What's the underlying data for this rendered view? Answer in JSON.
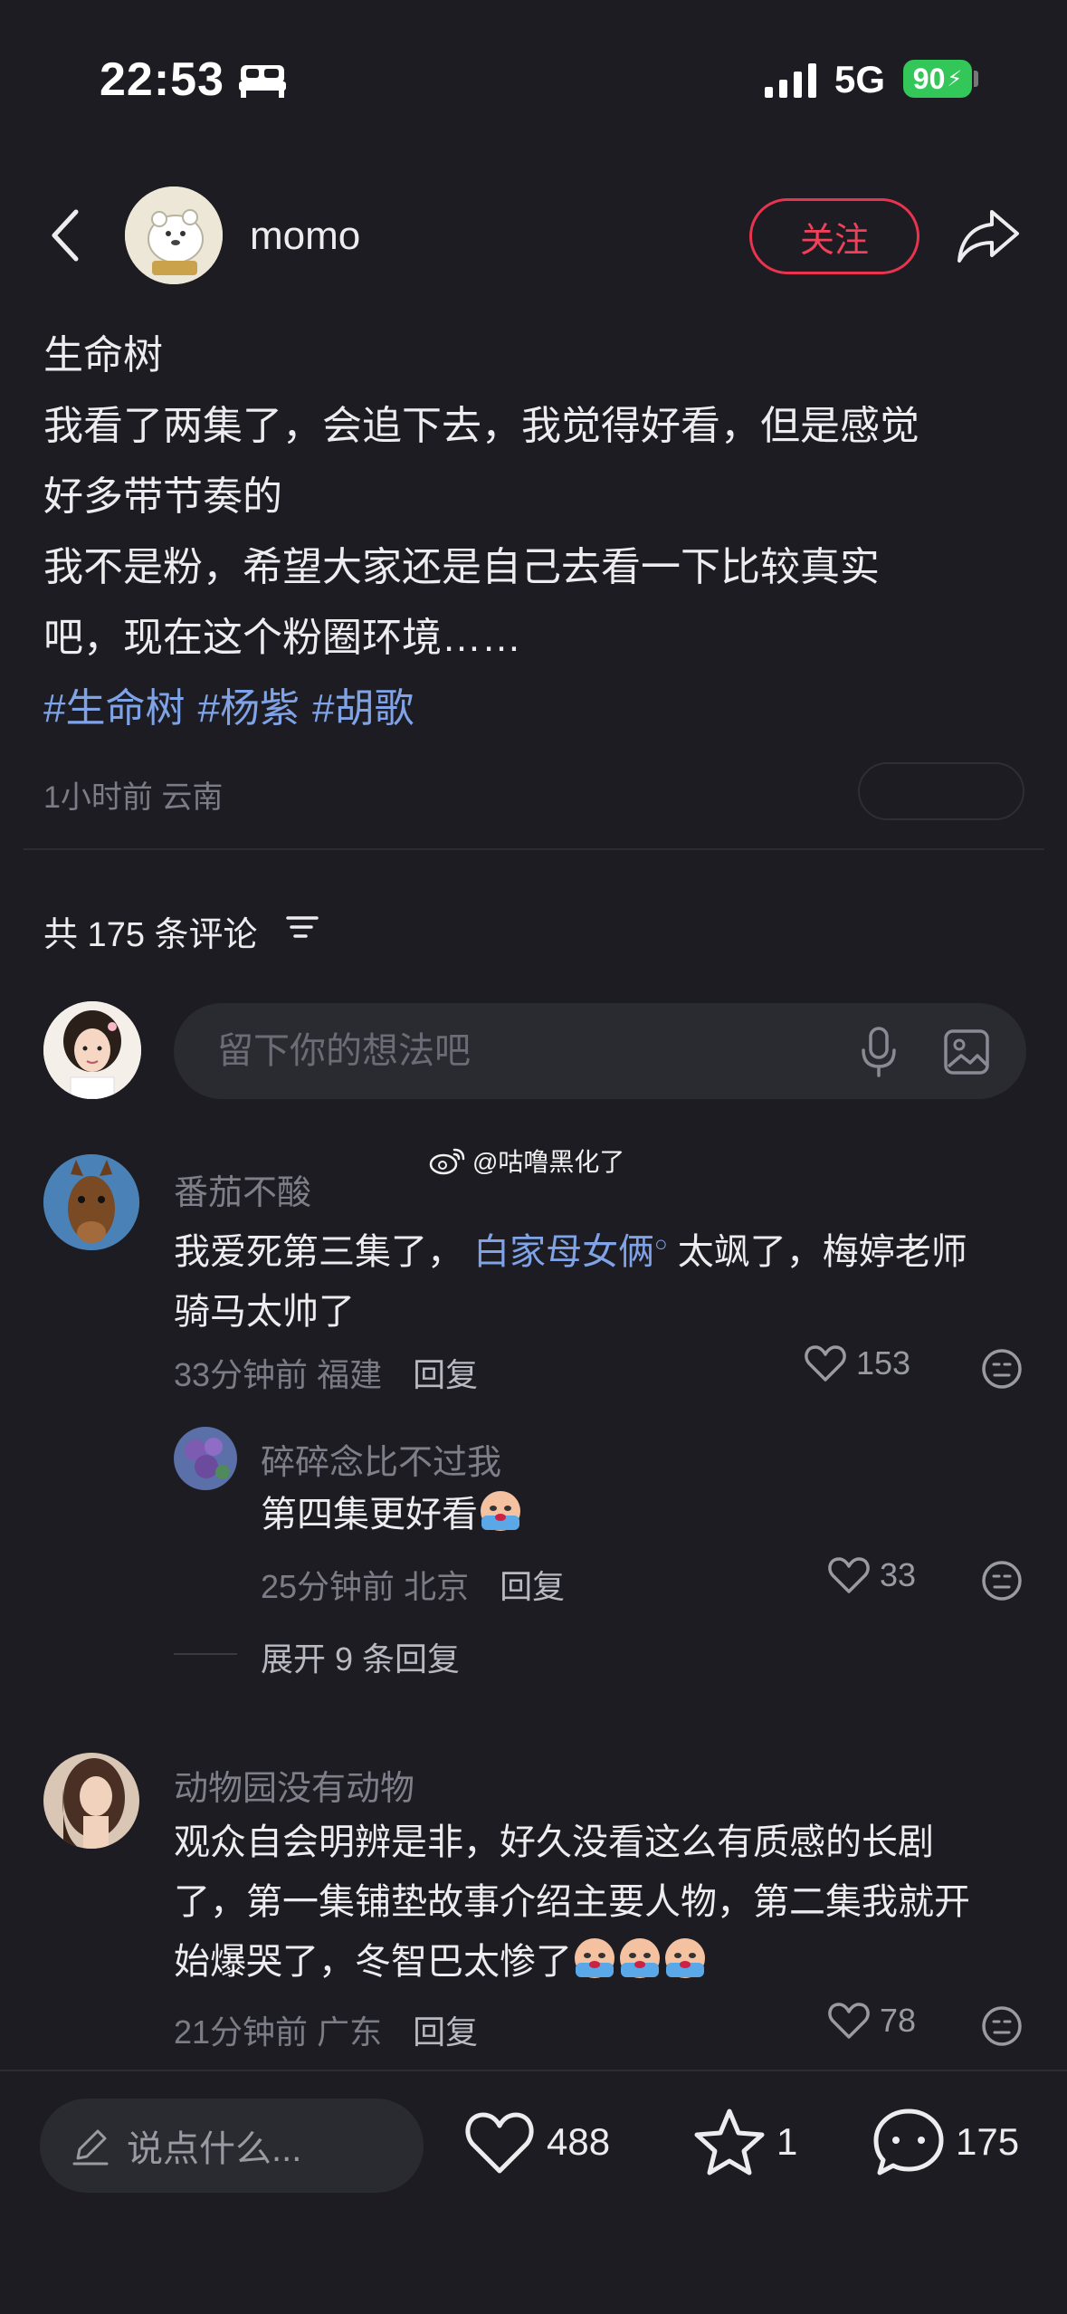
{
  "status_bar": {
    "time": "22:53",
    "network": "5G",
    "battery": "90"
  },
  "header": {
    "author": "momo",
    "follow_label": "关注"
  },
  "post": {
    "lines": [
      "生命树",
      "我看了两集了，会追下去，我觉得好看，但是感觉",
      "好多带节奏的",
      "我不是粉，希望大家还是自己去看一下比较真实",
      "吧，现在这个粉圈环境……"
    ],
    "tags": [
      "#生命树",
      "#杨紫",
      "#胡歌"
    ],
    "meta": "1小时前 云南"
  },
  "comments_header": {
    "count_label": "共 175 条评论"
  },
  "comment_input": {
    "placeholder": "留下你的想法吧"
  },
  "watermark": "@咕噜黑化了",
  "comments": [
    {
      "name": "番茄不酸",
      "text_before": "我爱死第三集了，",
      "mention": "白家母女俩",
      "text_after": "太飒了，梅婷老师",
      "text_line2": "骑马太帅了",
      "time": "33分钟前",
      "location": "福建",
      "reply_label": "回复",
      "likes": "153"
    },
    {
      "name": "碎碎念比不过我",
      "text": "第四集更好看",
      "time": "25分钟前",
      "location": "北京",
      "reply_label": "回复",
      "likes": "33"
    },
    {
      "name": "动物园没有动物",
      "text_line1": "观众自会明辨是非，好久没看这么有质感的长剧",
      "text_line2": "了，第一集铺垫故事介绍主要人物，第二集我就开",
      "text_line3": "始爆哭了，冬智巴太惨了",
      "time": "21分钟前",
      "location": "广东",
      "reply_label": "回复",
      "likes": "78"
    }
  ],
  "expand_label": "展开 9 条回复",
  "bottom_bar": {
    "say_placeholder": "说点什么...",
    "likes": "488",
    "favorites": "1",
    "comments": "175"
  },
  "colors": {
    "background": "#1c1c22",
    "follow": "#e8344e",
    "link": "#7fa3e6",
    "battery": "#33c659"
  }
}
